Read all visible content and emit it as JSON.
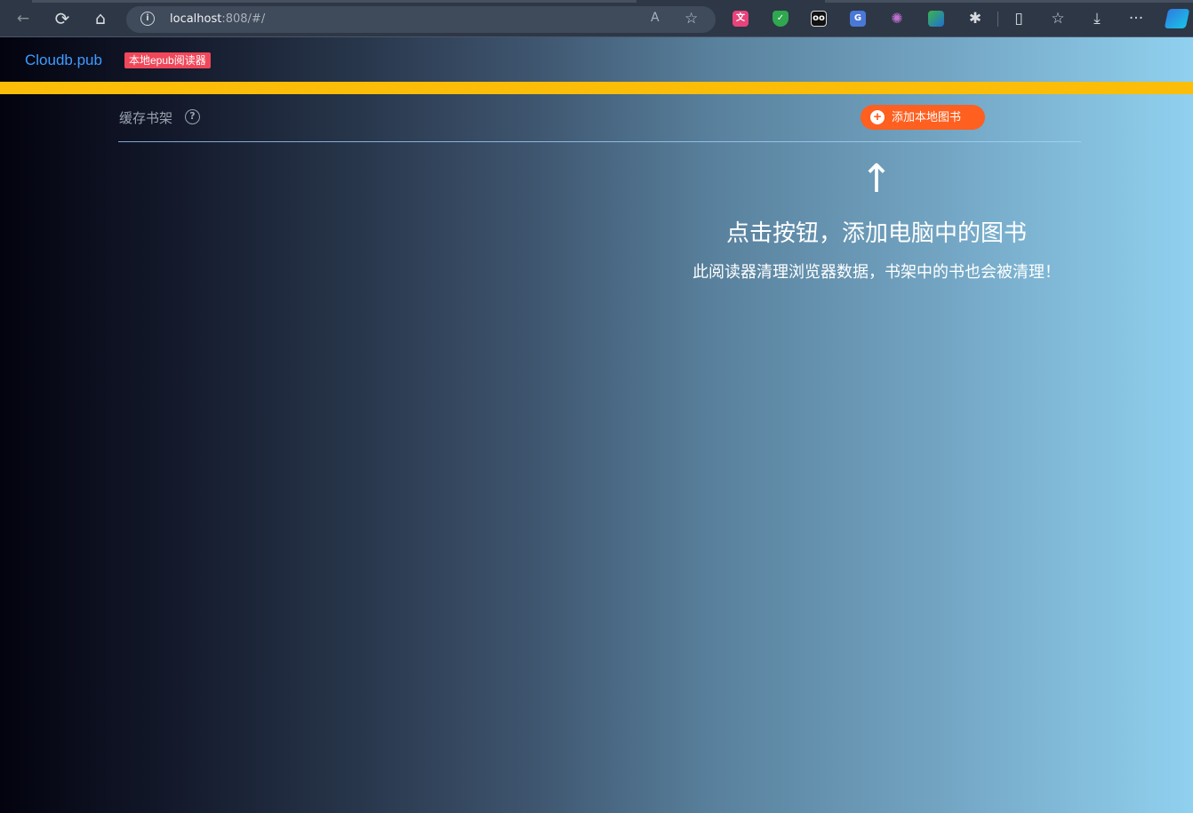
{
  "browser": {
    "url_host": "localhost",
    "url_rest": ":808/#/",
    "icons": {
      "back": "←",
      "refresh": "⟳",
      "home": "⌂",
      "info": "i",
      "read_aloud": "A",
      "favorite": "☆",
      "extensions": "✱",
      "split": "▯",
      "favorites": "☆",
      "download": "⤓",
      "more": "···"
    }
  },
  "header": {
    "logo": "Cloudb.pub",
    "badge": "本地epub阅读器"
  },
  "shelf": {
    "title": "缓存书架",
    "help_icon": "?",
    "add_button_icon": "+",
    "add_button_label": "添加本地图书"
  },
  "empty_state": {
    "arrow": "↑",
    "title": "点击按钮，添加电脑中的图书",
    "subtitle": "此阅读器清理浏览器数据，书架中的书也会被清理！"
  },
  "colors": {
    "logo": "#3f9bff",
    "badge": "#f0485a",
    "accent_bar": "#fbbd08",
    "add_button": "#ff5f1f"
  }
}
